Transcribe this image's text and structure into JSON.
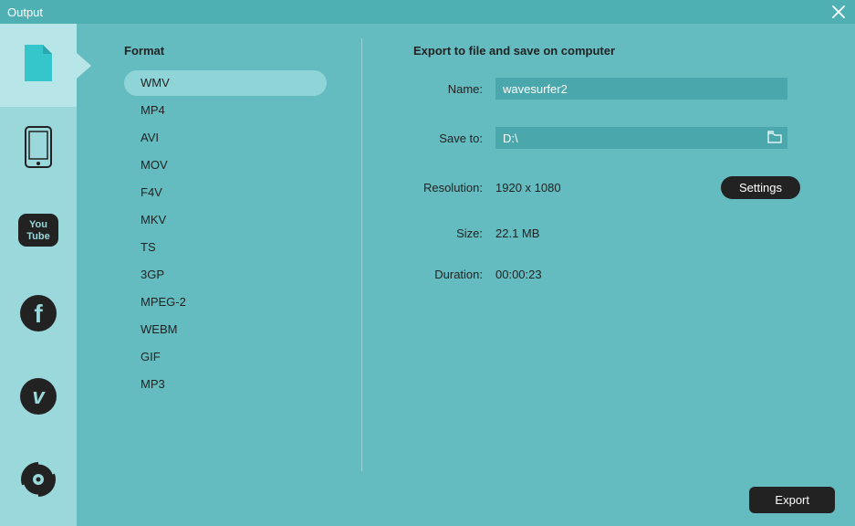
{
  "window": {
    "title": "Output"
  },
  "sidebar": {
    "items": [
      {
        "name": "file",
        "active": true
      },
      {
        "name": "device",
        "active": false
      },
      {
        "name": "youtube",
        "active": false
      },
      {
        "name": "facebook",
        "active": false
      },
      {
        "name": "vimeo",
        "active": false
      },
      {
        "name": "dvd",
        "active": false
      }
    ]
  },
  "format": {
    "heading": "Format",
    "items": [
      "WMV",
      "MP4",
      "AVI",
      "MOV",
      "F4V",
      "MKV",
      "TS",
      "3GP",
      "MPEG-2",
      "WEBM",
      "GIF",
      "MP3"
    ],
    "selected": "WMV"
  },
  "details": {
    "heading": "Export to file and save on computer",
    "name_label": "Name:",
    "name_value": "wavesurfer2",
    "saveto_label": "Save to:",
    "saveto_value": "D:\\",
    "resolution_label": "Resolution:",
    "resolution_value": "1920 x 1080",
    "settings_label": "Settings",
    "size_label": "Size:",
    "size_value": "22.1 MB",
    "duration_label": "Duration:",
    "duration_value": "00:00:23"
  },
  "export_button": "Export"
}
